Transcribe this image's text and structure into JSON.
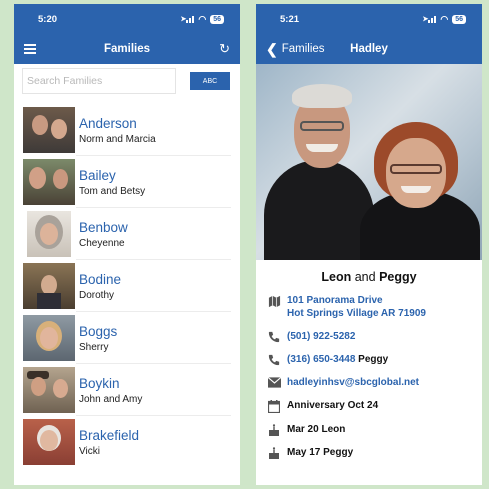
{
  "left": {
    "status": {
      "time": "5:20",
      "battery": "56"
    },
    "nav": {
      "title": "Families"
    },
    "search": {
      "placeholder": "Search Families",
      "button_label": "ABC"
    },
    "families": [
      {
        "name": "Anderson",
        "members": "Norm and Marcia"
      },
      {
        "name": "Bailey",
        "members": "Tom and Betsy"
      },
      {
        "name": "Benbow",
        "members": "Cheyenne"
      },
      {
        "name": "Bodine",
        "members": "Dorothy"
      },
      {
        "name": "Boggs",
        "members": "Sherry"
      },
      {
        "name": "Boykin",
        "members": "John and Amy"
      },
      {
        "name": "Brakefield",
        "members": "Vicki"
      }
    ]
  },
  "right": {
    "status": {
      "time": "5:21",
      "battery": "56"
    },
    "nav": {
      "back_label": "Families",
      "title": "Hadley"
    },
    "names": {
      "first": "Leon",
      "and": "and",
      "second": "Peggy"
    },
    "address": {
      "line1": "101 Panorama Drive",
      "line2": "Hot Springs Village  AR 71909"
    },
    "phones": [
      {
        "number": "(501) 922-5282",
        "person": ""
      },
      {
        "number": "(316) 650-3448",
        "person": "Peggy"
      }
    ],
    "email": "hadleyinhsv@sbcglobal.net",
    "anniversary": "Anniversary Oct 24",
    "birthdays": [
      "Mar 20 Leon",
      "May 17 Peggy"
    ]
  },
  "colors": {
    "brand": "#2b63ad",
    "background": "#cfe6c9"
  }
}
